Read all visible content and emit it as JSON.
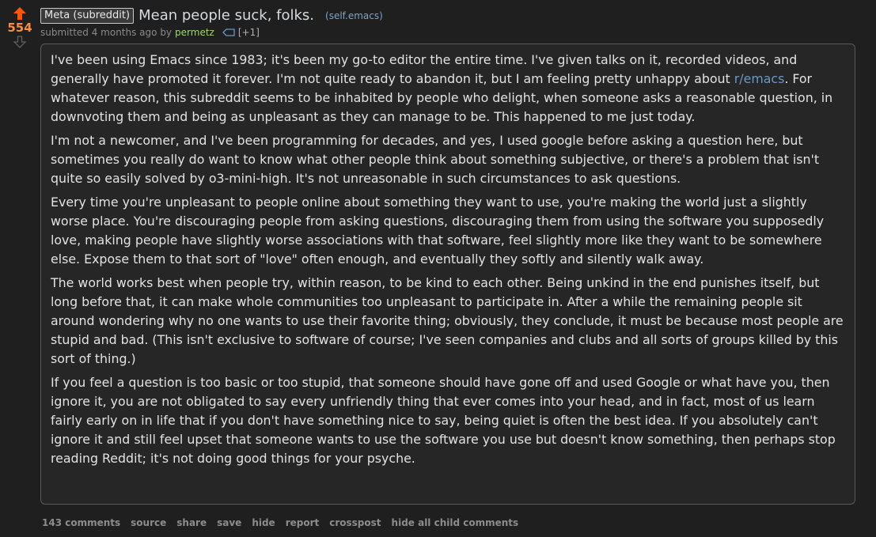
{
  "post": {
    "score": "554",
    "flair": "Meta (subreddit)",
    "title": "Mean people suck, folks.",
    "domain": "(self.emacs)",
    "submitted_prefix": "submitted 4 months ago by",
    "author": "permetz",
    "tag_count": "[+1]"
  },
  "body": {
    "p1_before_link": "I've been using Emacs since 1983; it's been my go-to editor the entire time. I've given talks on it, recorded videos, and generally have promoted it forever. I'm not quite ready to abandon it, but I am feeling pretty unhappy about ",
    "p1_link": "r/emacs",
    "p1_after_link": ". For whatever reason, this subreddit seems to be inhabited by people who delight, when someone asks a reasonable question, in downvoting them and being as unpleasant as they can manage to be. This happened to me just today.",
    "p2": "I'm not a newcomer, and I've been programming for decades, and yes, I used google before asking a question here, but sometimes you really do want to know what other people think about something subjective, or there's a problem that isn't quite so easily solved by o3-mini-high. It's not unreasonable in such circumstances to ask questions.",
    "p3": "Every time you're unpleasant to people online about something they want to use, you're making the world just a slightly worse place. You're discouraging people from asking questions, discouraging them from using the software you supposedly love, making people have slightly worse associations with that software, feel slightly more like they want to be somewhere else. Expose them to that sort of \"love\" often enough, and eventually they softly and silently walk away.",
    "p4": "The world works best when people try, within reason, to be kind to each other. Being unkind in the end punishes itself, but long before that, it can make whole communities too unpleasant to participate in. After a while the remaining people sit around wondering why no one wants to use their favorite thing; obviously, they conclude, it must be because most people are stupid and bad. (This isn't exclusive to software of course; I've seen companies and clubs and all sorts of groups killed by this sort of thing.)",
    "p5": "If you feel a question is too basic or too stupid, that someone should have gone off and used Google or what have you, then ignore it, you are not obligated to say every unfriendly thing that ever comes into your head, and in fact, most of us learn fairly early on in life that if you don't have something nice to say, being quiet is often the best idea. If you absolutely can't ignore it and still feel upset that someone wants to use the software you use but doesn't know something, then perhaps stop reading Reddit; it's not doing good things for your psyche."
  },
  "buttons": {
    "comments": "143 comments",
    "source": "source",
    "share": "share",
    "save": "save",
    "hide": "hide",
    "report": "report",
    "crosspost": "crosspost",
    "hide_children": "hide all child comments"
  },
  "colors": {
    "upvote": "#ff5700",
    "score": "#ff8b3c",
    "author": "#9bd76b",
    "link": "#6a98c7",
    "background": "#1f1f1f"
  },
  "icons": {
    "upvote": "arrow-up-icon",
    "downvote": "arrow-down-icon",
    "tag": "tag-icon"
  }
}
